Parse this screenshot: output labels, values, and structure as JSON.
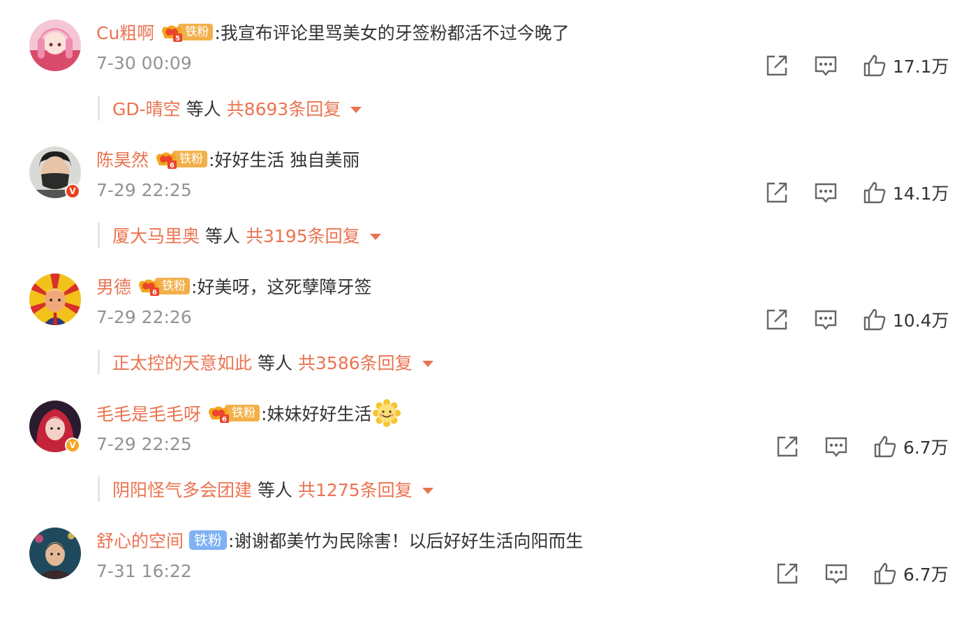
{
  "comments": [
    {
      "username": "Cu粗啊",
      "fan_label": "铁粉",
      "fan_level": "5",
      "text": ":我宣布评论里骂美女的牙签粉都活不过今晚了",
      "time": "7-30 00:09",
      "likes": "17.1万",
      "reply_name": "GD-晴空",
      "reply_etc": "等人",
      "reply_total": "共8693条回复"
    },
    {
      "username": "陈昊然",
      "fan_label": "铁粉",
      "fan_level": "6",
      "text": ":好好生活 独自美丽",
      "time": "7-29 22:25",
      "likes": "14.1万",
      "reply_name": "厦大马里奥",
      "reply_etc": "等人",
      "reply_total": "共3195条回复"
    },
    {
      "username": "男德",
      "fan_label": "铁粉",
      "fan_level": "6",
      "text": ":好美呀，这死孽障牙签",
      "time": "7-29 22:26",
      "likes": "10.4万",
      "reply_name": "正太控的天意如此",
      "reply_etc": "等人",
      "reply_total": "共3586条回复"
    },
    {
      "username": "毛毛是毛毛呀",
      "fan_label": "铁粉",
      "fan_level": "6",
      "text": ":妹妹好好生活",
      "time": "7-29 22:25",
      "likes": "6.7万",
      "reply_name": "阴阳怪气多会团建",
      "reply_etc": "等人",
      "reply_total": "共1275条回复"
    },
    {
      "username": "舒心的空间",
      "fan_label": "铁粉",
      "text": ":谢谢都美竹为民除害！以后好好生活向阳而生",
      "time": "7-31 16:22",
      "likes": "6.7万"
    }
  ],
  "colors": {
    "accent": "#eb7350",
    "time": "#939393",
    "fan_gold": "#f2b04a",
    "fan_blue": "#7fb2f3",
    "verified_red": "#e8421f",
    "verified_gold": "#f5a623"
  },
  "icons": {
    "share": "share-icon",
    "reply": "comment-icon",
    "like": "thumbs-up-icon",
    "expand": "caret-down-icon"
  }
}
